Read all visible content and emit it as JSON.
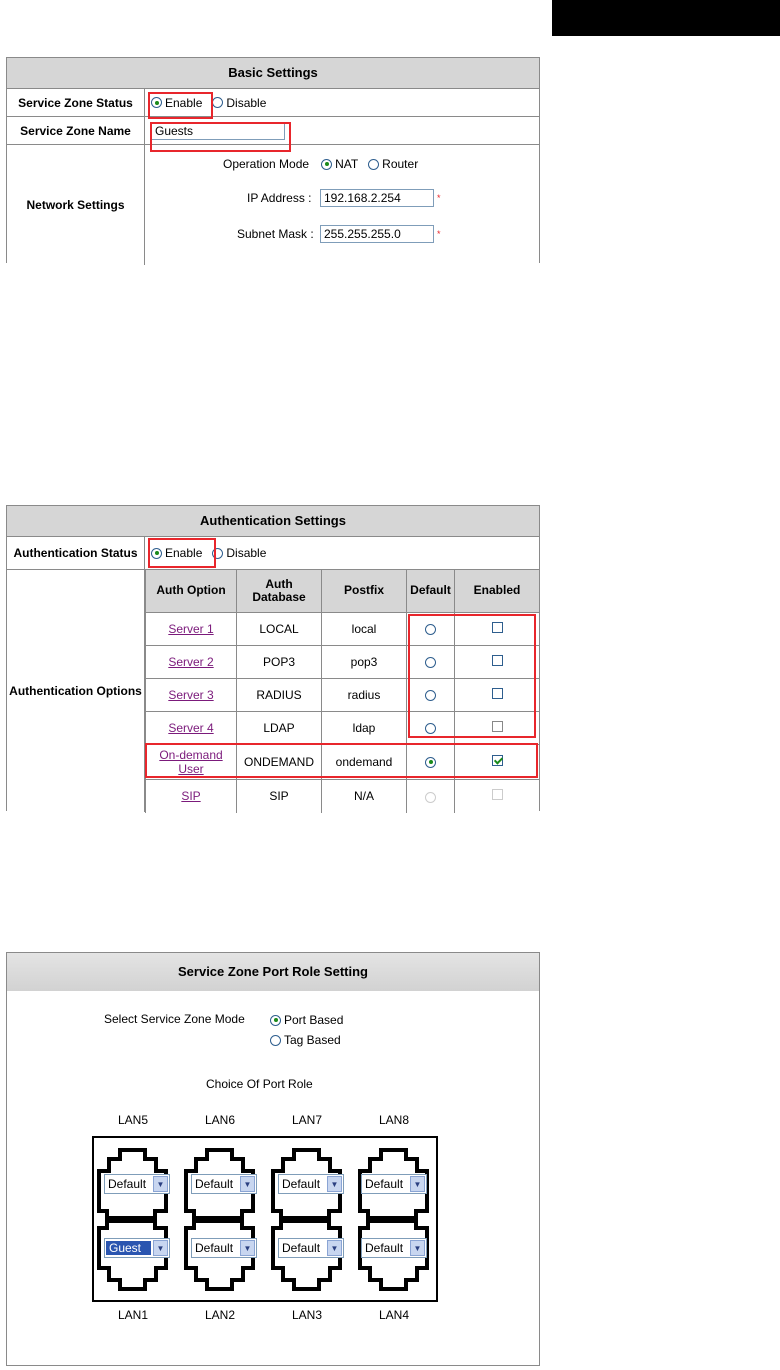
{
  "basic": {
    "title": "Basic Settings",
    "status_label": "Service Zone Status",
    "enable_label": "Enable",
    "disable_label": "Disable",
    "name_label": "Service Zone Name",
    "name_value": "Guests",
    "network_label": "Network Settings",
    "op_mode_label": "Operation Mode",
    "nat_label": "NAT",
    "router_label": "Router",
    "ip_label": "IP Address :",
    "ip_value": "192.168.2.254",
    "mask_label": "Subnet Mask :",
    "mask_value": "255.255.255.0",
    "required_mark": "*"
  },
  "auth": {
    "title": "Authentication Settings",
    "status_label": "Authentication Status",
    "enable_label": "Enable",
    "disable_label": "Disable",
    "options_label": "Authentication Options",
    "headers": {
      "option": "Auth Option",
      "database_1": "Auth",
      "database_2": "Database",
      "postfix": "Postfix",
      "default": "Default",
      "enabled": "Enabled"
    },
    "rows": [
      {
        "option": "Server 1",
        "database": "LOCAL",
        "postfix": "local"
      },
      {
        "option": "Server 2",
        "database": "POP3",
        "postfix": "pop3"
      },
      {
        "option": "Server 3",
        "database": "RADIUS",
        "postfix": "radius"
      },
      {
        "option": "Server 4",
        "database": "LDAP",
        "postfix": "ldap"
      },
      {
        "option_1": "On-demand",
        "option_2": "User",
        "database": "ONDEMAND",
        "postfix": "ondemand"
      },
      {
        "option": "SIP",
        "database": "SIP",
        "postfix": "N/A"
      }
    ]
  },
  "port": {
    "title": "Service Zone Port Role Setting",
    "mode_label": "Select Service Zone Mode",
    "port_based": "Port Based",
    "tag_based": "Tag Based",
    "choice_label": "Choice Of Port Role",
    "top_lans": [
      "LAN5",
      "LAN6",
      "LAN7",
      "LAN8"
    ],
    "bottom_lans": [
      "LAN1",
      "LAN2",
      "LAN3",
      "LAN4"
    ],
    "top_roles": [
      "Default",
      "Default",
      "Default",
      "Default"
    ],
    "bottom_roles": [
      "Guest",
      "Default",
      "Default",
      "Default"
    ],
    "arrow_glyph": "▼"
  }
}
